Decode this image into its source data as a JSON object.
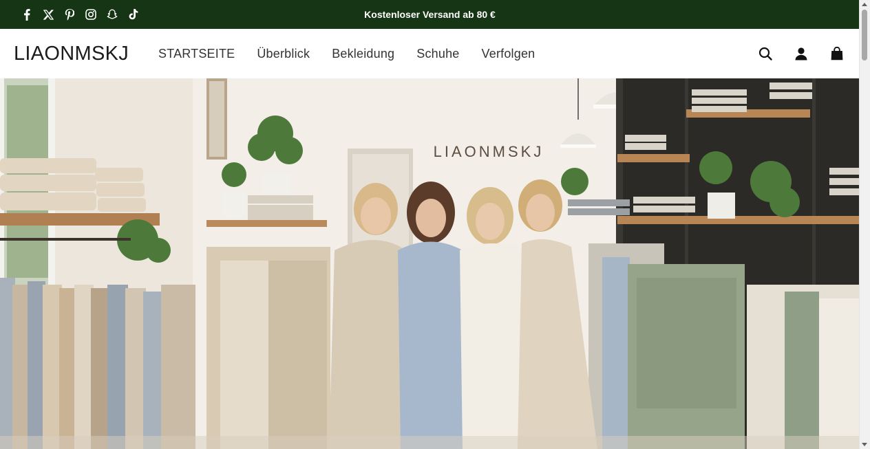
{
  "announcement": {
    "text": "Kostenloser Versand ab 80 €",
    "background": "#163514",
    "social_icons": [
      "facebook-icon",
      "x-icon",
      "pinterest-icon",
      "instagram-icon",
      "snapchat-icon",
      "tiktok-icon"
    ]
  },
  "header": {
    "logo": "LIAONMSKJ",
    "nav": [
      "STARTSEITE",
      "Überblick",
      "Bekleidung",
      "Schuhe",
      "Verfolgen"
    ],
    "icons": [
      "search-icon",
      "account-icon",
      "cart-icon"
    ]
  },
  "hero": {
    "store_sign": "LIAONMSKJ",
    "description": "hero-photo"
  }
}
